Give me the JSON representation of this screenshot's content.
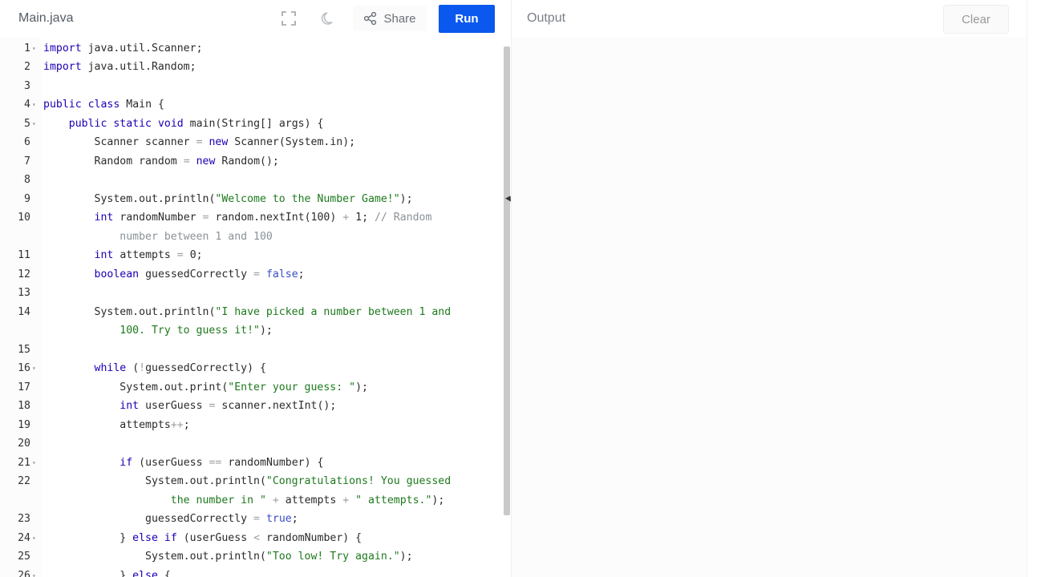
{
  "toolbar": {
    "filename": "Main.java",
    "fullscreen_icon": "fullscreen-icon",
    "theme_icon": "moon-icon",
    "share_icon": "share-icon",
    "share_label": "Share",
    "run_label": "Run"
  },
  "output": {
    "label": "Output",
    "clear_label": "Clear"
  },
  "code_lines": [
    {
      "num": "1",
      "fold": true
    },
    {
      "num": "2"
    },
    {
      "num": "3"
    },
    {
      "num": "4",
      "fold": true
    },
    {
      "num": "5",
      "fold": true
    },
    {
      "num": "6"
    },
    {
      "num": "7"
    },
    {
      "num": "8"
    },
    {
      "num": "9"
    },
    {
      "num": "10"
    },
    {
      "num": ""
    },
    {
      "num": "11"
    },
    {
      "num": "12"
    },
    {
      "num": "13"
    },
    {
      "num": "14"
    },
    {
      "num": ""
    },
    {
      "num": "15"
    },
    {
      "num": "16",
      "fold": true
    },
    {
      "num": "17"
    },
    {
      "num": "18"
    },
    {
      "num": "19"
    },
    {
      "num": "20"
    },
    {
      "num": "21",
      "fold": true
    },
    {
      "num": "22"
    },
    {
      "num": ""
    },
    {
      "num": "23"
    },
    {
      "num": "24",
      "fold": true
    },
    {
      "num": "25"
    },
    {
      "num": "26",
      "fold": true
    }
  ],
  "code_text": {
    "l1": "java.util.Scanner;",
    "l2": "java.util.Random;",
    "l4": "Main {",
    "l5a": "main(String[] args) {",
    "l6a": "Scanner scanner ",
    "l6b": "Scanner(System.in);",
    "l7a": "Random random ",
    "l7b": "Random();",
    "l9a": "System.out.println(",
    "l9b": "\"Welcome to the Number Game!\"",
    "l9c": ");",
    "l10a": "randomNumber ",
    "l10b": "random.nextInt(100) ",
    "l10c": "1; ",
    "l10d": "// Random",
    "l10e": "number between 1 and 100",
    "l11a": "attempts ",
    "l11b": "0;",
    "l12a": "guessedCorrectly ",
    "l12b": "false",
    "l12c": ";",
    "l14a": "System.out.println(",
    "l14b": "\"I have picked a number between 1 and",
    "l14c": "100. Try to guess it!\"",
    "l14d": ");",
    "l16a": "(",
    "l16b": "!",
    "l16c": "guessedCorrectly) {",
    "l17a": "System.out.print(",
    "l17b": "\"Enter your guess: \"",
    "l17c": ");",
    "l18a": "userGuess ",
    "l18b": "scanner.nextInt();",
    "l19a": "attempts",
    "l19b": "++",
    "l19c": ";",
    "l21a": "(userGuess ",
    "l21b": "randomNumber) {",
    "l22a": "System.out.println(",
    "l22b": "\"Congratulations! You guessed",
    "l22c": "the number in \"",
    "l22d": "attempts ",
    "l22e": "\" attempts.\"",
    "l22f": ");",
    "l23a": "guessedCorrectly ",
    "l23b": "true",
    "l23c": ";",
    "l24a": "} ",
    "l24b": "(userGuess ",
    "l24c": "randomNumber) {",
    "l25a": "System.out.println(",
    "l25b": "\"Too low! Try again.\"",
    "l25c": ");",
    "l26a": "} "
  },
  "keywords": {
    "import": "import",
    "public": "public",
    "class": "class",
    "static": "static",
    "void": "void",
    "new": "new",
    "int": "int",
    "boolean": "boolean",
    "while": "while",
    "if": "if",
    "else": "else",
    "eq": "=",
    "plus": "+",
    "eqeq": "==",
    "lt": "<"
  }
}
